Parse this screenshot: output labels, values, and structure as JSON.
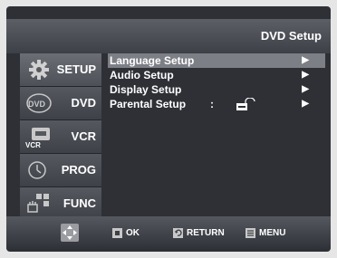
{
  "title": "DVD Setup",
  "sidebar": {
    "tabs": [
      {
        "label": "SETUP",
        "icon": "gear-icon",
        "active": true
      },
      {
        "label": "DVD",
        "icon": "dvd-icon",
        "active": false
      },
      {
        "label": "VCR",
        "icon": "vcr-icon",
        "active": false
      },
      {
        "label": "PROG",
        "icon": "clock-icon",
        "active": false
      },
      {
        "label": "FUNC",
        "icon": "function-icon",
        "active": false
      }
    ]
  },
  "menu": {
    "items": [
      {
        "label": "Language Setup",
        "selected": true
      },
      {
        "label": "Audio Setup",
        "selected": false
      },
      {
        "label": "Display Setup",
        "selected": false
      },
      {
        "label": "Parental Setup",
        "selected": false,
        "colon": ":",
        "icon": "lock-icon"
      }
    ],
    "arrow_glyph": "▶"
  },
  "hints": {
    "ok": "OK",
    "return": "RETURN",
    "menu": "MENU"
  },
  "colors": {
    "background": "#2e3036",
    "selected_row": "#7d7f86",
    "text": "#ffffff"
  }
}
